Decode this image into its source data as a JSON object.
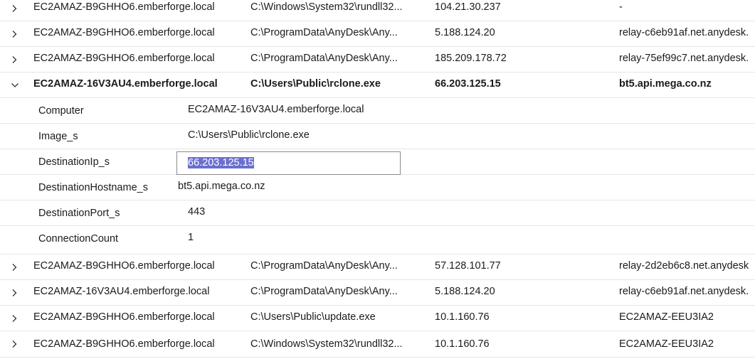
{
  "rows_top": [
    {
      "computer": "EC2AMAZ-B9GHHO6.emberforge.local",
      "image": "C:\\Windows\\System32\\rundll32...",
      "ip": "104.21.30.237",
      "hostname": "-"
    },
    {
      "computer": "EC2AMAZ-B9GHHO6.emberforge.local",
      "image": "C:\\ProgramData\\AnyDesk\\Any...",
      "ip": "5.188.124.20",
      "hostname": "relay-c6eb91af.net.anydesk."
    },
    {
      "computer": "EC2AMAZ-B9GHHO6.emberforge.local",
      "image": "C:\\ProgramData\\AnyDesk\\Any...",
      "ip": "185.209.178.72",
      "hostname": "relay-75ef99c7.net.anydesk."
    }
  ],
  "expanded_row": {
    "computer": "EC2AMAZ-16V3AU4.emberforge.local",
    "image": "C:\\Users\\Public\\rclone.exe",
    "ip": "66.203.125.15",
    "hostname": "bt5.api.mega.co.nz"
  },
  "details": [
    {
      "key": "Computer",
      "value": "EC2AMAZ-16V3AU4.emberforge.local"
    },
    {
      "key": "Image_s",
      "value": "C:\\Users\\Public\\rclone.exe"
    },
    {
      "key": "DestinationIp_s",
      "value": "66.203.125.15"
    },
    {
      "key": "DestinationHostname_s",
      "value": "bt5.api.mega.co.nz"
    },
    {
      "key": "DestinationPort_s",
      "value": "443"
    },
    {
      "key": "ConnectionCount",
      "value": "1"
    }
  ],
  "rows_bottom": [
    {
      "computer": "EC2AMAZ-B9GHHO6.emberforge.local",
      "image": "C:\\ProgramData\\AnyDesk\\Any...",
      "ip": "57.128.101.77",
      "hostname": "relay-2d2eb6c8.net.anydesk"
    },
    {
      "computer": "EC2AMAZ-16V3AU4.emberforge.local",
      "image": "C:\\ProgramData\\AnyDesk\\Any...",
      "ip": "5.188.124.20",
      "hostname": "relay-c6eb91af.net.anydesk."
    },
    {
      "computer": "EC2AMAZ-B9GHHO6.emberforge.local",
      "image": "C:\\Users\\Public\\update.exe",
      "ip": "10.1.160.76",
      "hostname": "EC2AMAZ-EEU3IA2"
    },
    {
      "computer": "EC2AMAZ-B9GHHO6.emberforge.local",
      "image": "C:\\Windows\\System32\\rundll32...",
      "ip": "10.1.160.76",
      "hostname": "EC2AMAZ-EEU3IA2"
    }
  ],
  "icons": {
    "collapsed": "chevron-right-icon",
    "expanded": "chevron-down-icon"
  }
}
